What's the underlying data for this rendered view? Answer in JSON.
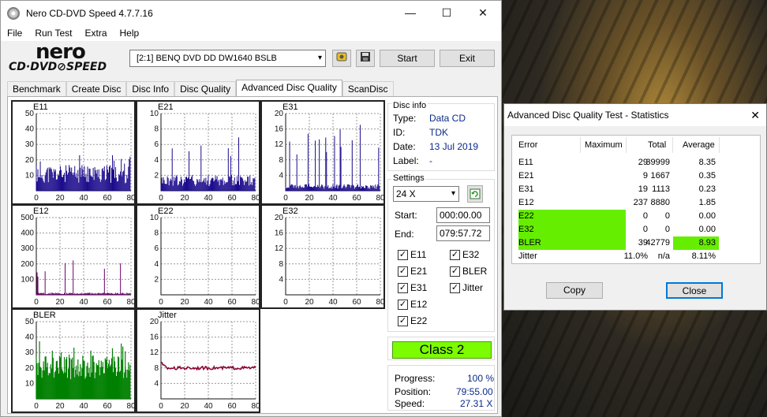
{
  "window": {
    "title": "Nero CD-DVD Speed 4.7.7.16",
    "minimize": "—",
    "maximize": "☐",
    "close": "✕"
  },
  "menu": [
    "File",
    "Run Test",
    "Extra",
    "Help"
  ],
  "logo": {
    "top": "nero",
    "bottom": "CD·DVD⊘SPEED"
  },
  "toolbar": {
    "drive": "[2:1]   BENQ DVD DD DW1640 BSLB",
    "start": "Start",
    "exit": "Exit"
  },
  "tabs": [
    "Benchmark",
    "Create Disc",
    "Disc Info",
    "Disc Quality",
    "Advanced Disc Quality",
    "ScanDisc"
  ],
  "charts": [
    {
      "name": "E11",
      "ymax": 50,
      "yticks": [
        50,
        40,
        30,
        20,
        10
      ],
      "color": "#1a0a8c",
      "kind": "bars",
      "base": 12,
      "spike": 25
    },
    {
      "name": "E21",
      "ymax": 10,
      "yticks": [
        10,
        8,
        6,
        4,
        2
      ],
      "color": "#1a0a8c",
      "kind": "bars",
      "base": 1.5,
      "spike": 8
    },
    {
      "name": "E31",
      "ymax": 20,
      "yticks": [
        20,
        16,
        12,
        8,
        4
      ],
      "color": "#1a0a8c",
      "kind": "bars",
      "base": 1.2,
      "spike": 18
    },
    {
      "name": "E12",
      "ymax": 500,
      "yticks": [
        500,
        400,
        300,
        200,
        100
      ],
      "color": "#6a006a",
      "kind": "bars",
      "base": 10,
      "spike": 230
    },
    {
      "name": "E22",
      "ymax": 10,
      "yticks": [
        10,
        8,
        6,
        4,
        2
      ],
      "color": "#1a0a8c",
      "kind": "empty"
    },
    {
      "name": "E32",
      "ymax": 20,
      "yticks": [
        20,
        16,
        12,
        8,
        4
      ],
      "color": "#1a0a8c",
      "kind": "empty"
    },
    {
      "name": "BLER",
      "ymax": 50,
      "yticks": [
        50,
        40,
        30,
        20,
        10
      ],
      "color": "#008000",
      "kind": "fill",
      "base": 18,
      "spike": 38
    },
    {
      "name": "Jitter",
      "ymax": 20,
      "yticks": [
        20,
        16,
        12,
        8,
        4
      ],
      "color": "#8b0030",
      "kind": "line",
      "base": 8
    }
  ],
  "xticks": [
    0,
    20,
    40,
    60,
    80
  ],
  "discinfo": {
    "label": "Disc info",
    "type_k": "Type:",
    "type_v": "Data CD",
    "id_k": "ID:",
    "id_v": "TDK",
    "date_k": "Date:",
    "date_v": "13 Jul 2019",
    "label_k": "Label:",
    "label_v": "-"
  },
  "settings": {
    "label": "Settings",
    "speed": "24 X",
    "start_k": "Start:",
    "start_v": "000:00.00",
    "end_k": "End:",
    "end_v": "079:57.72",
    "checks": [
      "E11",
      "E32",
      "E21",
      "BLER",
      "E31",
      "Jitter",
      "E12",
      "E22"
    ]
  },
  "class": "Class 2",
  "progress": {
    "progress_k": "Progress:",
    "progress_v": "100 %",
    "position_k": "Position:",
    "position_v": "79:55.00",
    "speed_k": "Speed:",
    "speed_v": "27.31 X"
  },
  "stats": {
    "title": "Advanced Disc Quality Test - Statistics",
    "close": "✕",
    "headers": [
      "Error",
      "Maximum",
      "Total",
      "Average"
    ],
    "rows": [
      [
        "E11",
        "29",
        "39999",
        "8.35"
      ],
      [
        "E21",
        "9",
        "1667",
        "0.35"
      ],
      [
        "E31",
        "19",
        "1113",
        "0.23"
      ],
      [
        "E12",
        "237",
        "8880",
        "1.85"
      ],
      [
        "E22",
        "0",
        "0",
        "0.00"
      ],
      [
        "E32",
        "0",
        "0",
        "0.00"
      ],
      [
        "BLER",
        "39",
        "42779",
        "8.93"
      ],
      [
        "Jitter",
        "11.0%",
        "n/a",
        "8.11%"
      ]
    ],
    "highlight_color": "#66ee00",
    "copy": "Copy",
    "close_btn": "Close"
  }
}
